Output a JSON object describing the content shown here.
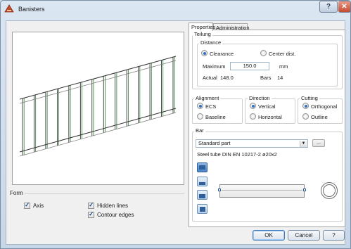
{
  "window": {
    "title": "Banisters",
    "help": "?",
    "close": "✕"
  },
  "tabs": [
    {
      "label": "Properties"
    },
    {
      "label": "Administration"
    }
  ],
  "teilung": {
    "label": "Teilung",
    "distance": {
      "label": "Distance",
      "options": [
        {
          "label": "Clearance",
          "selected": true
        },
        {
          "label": "Center dist.",
          "selected": false
        }
      ],
      "maximum_label": "Maximum",
      "maximum_value": "150.0",
      "unit": "mm",
      "actual_label": "Actual",
      "actual_value": "148.0",
      "bars_label": "Bars",
      "bars_value": "14"
    }
  },
  "alignment": {
    "label": "Alignment",
    "options": [
      {
        "label": "ECS",
        "selected": true
      },
      {
        "label": "Baseline",
        "selected": false
      }
    ]
  },
  "direction": {
    "label": "Direction",
    "options": [
      {
        "label": "Vertical",
        "selected": true
      },
      {
        "label": "Horizontal",
        "selected": false
      }
    ]
  },
  "cutting": {
    "label": "Cutting",
    "options": [
      {
        "label": "Orthogonal",
        "selected": true
      },
      {
        "label": "Outline",
        "selected": false
      }
    ]
  },
  "bar": {
    "label": "Bar",
    "select_value": "Standard part",
    "ellipsis": "...",
    "description": "Steel tube DIN EN 10217-2 ø20x2"
  },
  "form": {
    "label": "Form",
    "axis": {
      "label": "Axis",
      "checked": true
    },
    "hidden_lines": {
      "label": "Hidden lines",
      "checked": true
    },
    "contour_edges": {
      "label": "Contour edges",
      "checked": true
    }
  },
  "buttons": {
    "ok": "OK",
    "cancel": "Cancel",
    "help": "?"
  }
}
